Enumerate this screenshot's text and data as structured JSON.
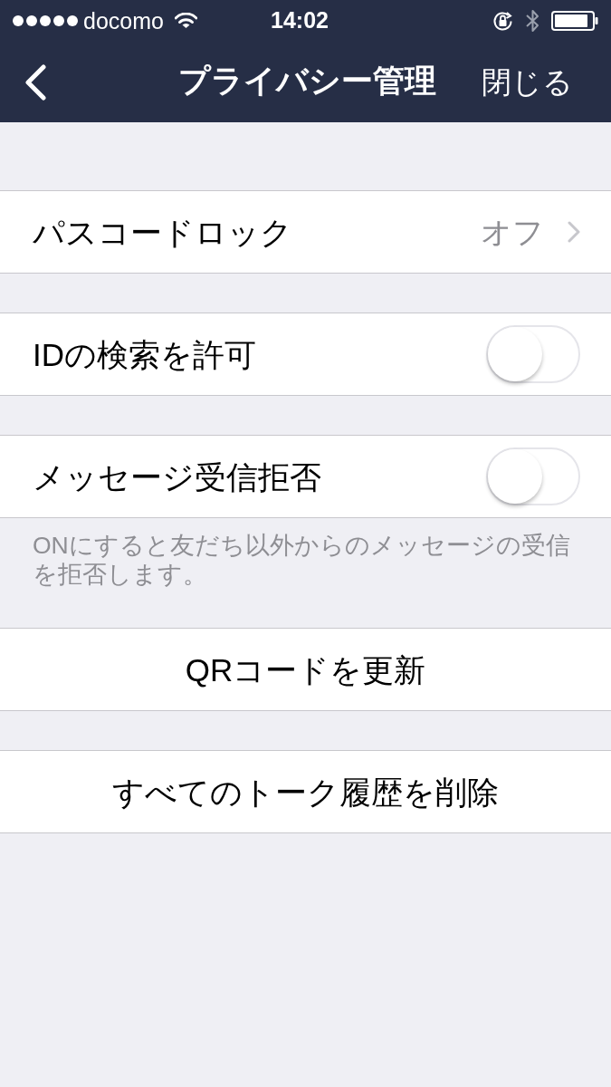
{
  "status_bar": {
    "carrier": "docomo",
    "time": "14:02"
  },
  "nav_bar": {
    "title": "プライバシー管理",
    "close_button": "閉じる"
  },
  "sections": [
    {
      "rows": [
        {
          "kind": "disclosure",
          "label": "パスコードロック",
          "value": "オフ"
        }
      ]
    },
    {
      "rows": [
        {
          "kind": "toggle",
          "label": "IDの検索を許可",
          "on": false
        }
      ]
    },
    {
      "rows": [
        {
          "kind": "toggle",
          "label": "メッセージ受信拒否",
          "on": false
        }
      ],
      "footer": "ONにすると友だち以外からのメッセージの受信を拒否します。"
    },
    {
      "rows": [
        {
          "kind": "action",
          "label": "QRコードを更新"
        }
      ]
    },
    {
      "rows": [
        {
          "kind": "action",
          "label": "すべてのトーク履歴を削除"
        }
      ]
    }
  ]
}
